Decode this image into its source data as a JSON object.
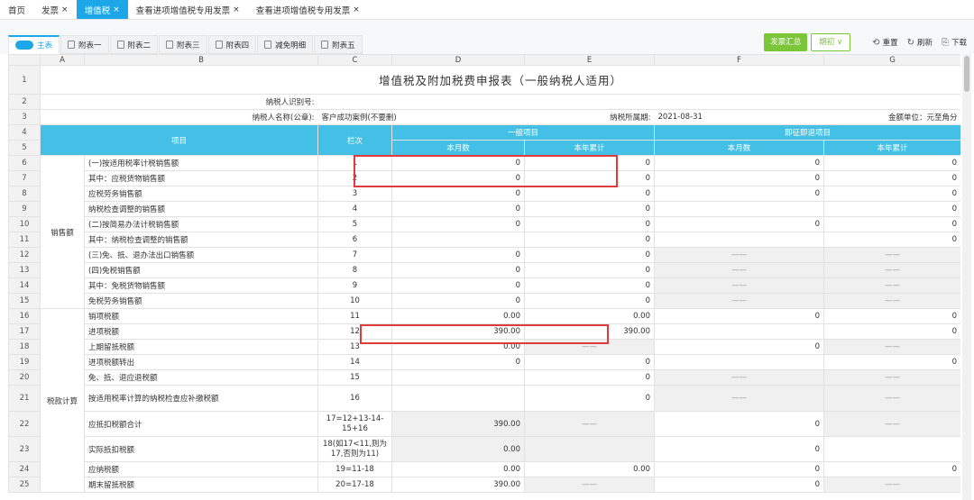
{
  "top_tabs": [
    {
      "label": "首页",
      "closable": false,
      "active": false
    },
    {
      "label": "发票",
      "closable": true,
      "active": false
    },
    {
      "label": "增值税",
      "closable": true,
      "active": true
    },
    {
      "label": "查看进项增值税专用发票",
      "closable": true,
      "active": false
    },
    {
      "label": "查看进项增值税专用发票",
      "closable": true,
      "active": false
    }
  ],
  "close_glyph": "×",
  "sub_tabs": [
    {
      "label": "主表",
      "active": true
    },
    {
      "label": "附表一",
      "active": false
    },
    {
      "label": "附表二",
      "active": false
    },
    {
      "label": "附表三",
      "active": false
    },
    {
      "label": "附表四",
      "active": false
    },
    {
      "label": "减免明细",
      "active": false
    },
    {
      "label": "附表五",
      "active": false
    }
  ],
  "actions": {
    "invoice_summary": "发票汇总",
    "period": "期初",
    "reset": "重置",
    "refresh": "刷新",
    "download": "下载"
  },
  "icons": {
    "period_dropdown": "chevron-down-icon",
    "reset": "reset-icon",
    "refresh": "refresh-icon",
    "download": "download-icon"
  },
  "columns": [
    "A",
    "B",
    "C",
    "D",
    "E",
    "F",
    "G"
  ],
  "title": "增值税及附加税费申报表（一般纳税人适用）",
  "taxpayer_id_label": "纳税人识别号:",
  "taxpayer_name_label": "纳税人名称(公章):",
  "taxpayer_name": "客户成功案例(不要删)",
  "period_label": "纳税所属期:",
  "period_value": "2021-08-31",
  "unit_label": "金额单位：元至角分",
  "header": {
    "item": "项目",
    "lanci": "栏次",
    "general": "一般项目",
    "immediate": "即征即退项目",
    "month": "本月数",
    "year": "本年累计"
  },
  "groups": {
    "sales": "销售额",
    "tax": "税款计算"
  },
  "rows": [
    {
      "n": "6",
      "item": "(一)按适用税率计税销售额",
      "lanci": "1",
      "d": "0",
      "e": "0",
      "f": "0",
      "g": "0"
    },
    {
      "n": "7",
      "item": "其中：应税货物销售额",
      "lanci": "2",
      "d": "0",
      "e": "0",
      "f": "0",
      "g": "0"
    },
    {
      "n": "8",
      "item": "应税劳务销售额",
      "lanci": "3",
      "d": "0",
      "e": "0",
      "f": "0",
      "g": "0"
    },
    {
      "n": "9",
      "item": "纳税检查调整的销售额",
      "lanci": "4",
      "d": "0",
      "e": "0",
      "f": "",
      "g": "0"
    },
    {
      "n": "10",
      "item": "(二)按简易办法计税销售额",
      "lanci": "5",
      "d": "0",
      "e": "0",
      "f": "0",
      "g": "0"
    },
    {
      "n": "11",
      "item": "其中：纳税检查调整的销售额",
      "lanci": "6",
      "d": "",
      "e": "0",
      "f": "",
      "g": "0"
    },
    {
      "n": "12",
      "item": "(三)免、抵、退办法出口销售额",
      "lanci": "7",
      "d": "0",
      "e": "0",
      "f": "——",
      "g": "——"
    },
    {
      "n": "13",
      "item": "(四)免税销售额",
      "lanci": "8",
      "d": "0",
      "e": "0",
      "f": "——",
      "g": "——"
    },
    {
      "n": "14",
      "item": "其中：免税货物销售额",
      "lanci": "9",
      "d": "0",
      "e": "0",
      "f": "——",
      "g": "——"
    },
    {
      "n": "15",
      "item": "免税劳务销售额",
      "lanci": "10",
      "d": "0",
      "e": "0",
      "f": "——",
      "g": "——"
    },
    {
      "n": "16",
      "item": "销项税额",
      "lanci": "11",
      "d": "0.00",
      "e": "0.00",
      "f": "0",
      "g": "0"
    },
    {
      "n": "17",
      "item": "进项税额",
      "lanci": "12",
      "d": "390.00",
      "e": "390.00",
      "f": "",
      "g": "0"
    },
    {
      "n": "18",
      "item": "上期留抵税额",
      "lanci": "13",
      "d": "0.00",
      "e": "——",
      "f": "0",
      "g": "——"
    },
    {
      "n": "19",
      "item": "进项税额转出",
      "lanci": "14",
      "d": "0",
      "e": "0",
      "f": "",
      "g": "0"
    },
    {
      "n": "20",
      "item": "免、抵、退应退税额",
      "lanci": "15",
      "d": "",
      "e": "0",
      "f": "——",
      "g": "——"
    },
    {
      "n": "21",
      "item": "按适用税率计算的纳税检查应补缴税额",
      "lanci": "16",
      "d": "",
      "e": "0",
      "f": "——",
      "g": "——"
    },
    {
      "n": "22",
      "item": "应抵扣税额合计",
      "lanci": "17=12+13-14-15+16",
      "d": "390.00",
      "e": "——",
      "f": "0",
      "g": "——"
    },
    {
      "n": "23",
      "item": "实际抵扣税额",
      "lanci": "18(如17<11,则为17,否则为11)",
      "d": "0.00",
      "e": "",
      "f": "0",
      "g": ""
    },
    {
      "n": "24",
      "item": "应纳税额",
      "lanci": "19=11-18",
      "d": "0.00",
      "e": "0.00",
      "f": "0",
      "g": "0"
    },
    {
      "n": "25",
      "item": "期末留抵税额",
      "lanci": "20=17-18",
      "d": "390.00",
      "e": "——",
      "f": "0",
      "g": "——"
    }
  ],
  "colors": {
    "accent": "#1ba7e8",
    "header_cyan": "#44c0e6",
    "green": "#7cc639",
    "highlight": "#e03b3b"
  }
}
